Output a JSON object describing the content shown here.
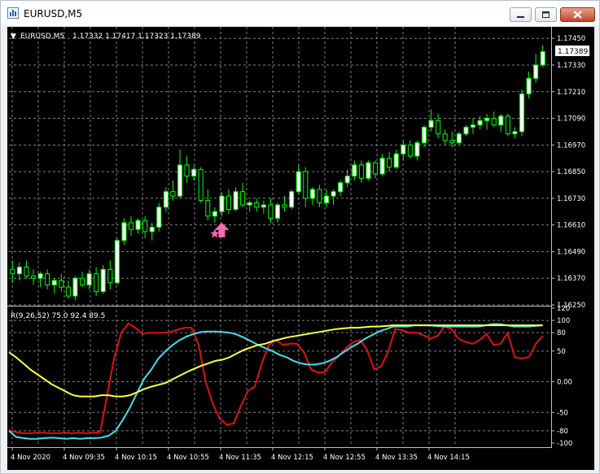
{
  "window": {
    "title": "EURUSD,M5"
  },
  "chart_header": {
    "symbol_tf": "EURUSD,M5",
    "ohlc": "1.17332 1.17417 1.17323 1.17389"
  },
  "indicator_header": {
    "label": "R(9,26,52) 75.0 92.4 89.5"
  },
  "colors": {
    "background": "#000000",
    "grid": "#808080",
    "bull_candle": "#ffffff",
    "bear_candle": "#000000",
    "wick": "#00ff00",
    "line_red": "#e01010",
    "line_cyan": "#40e0f0",
    "line_yellow": "#ffff40",
    "arrow": "#ff69b4",
    "price_label_bg": "#ffffff"
  },
  "price_axis": {
    "ticks": [
      "1.17450",
      "1.17330",
      "1.17210",
      "1.17090",
      "1.16970",
      "1.16850",
      "1.16730",
      "1.16610",
      "1.16490",
      "1.16370",
      "1.16250"
    ],
    "current_price": "1.17389"
  },
  "indicator_axis": {
    "ticks": [
      "120",
      "100",
      "80",
      "50",
      "0.00",
      "-50",
      "-80",
      "-100"
    ]
  },
  "time_axis": {
    "labels": [
      "4 Nov 2020",
      "4 Nov 09:35",
      "4 Nov 10:15",
      "4 Nov 10:55",
      "4 Nov 11:35",
      "4 Nov 12:15",
      "4 Nov 12:55",
      "4 Nov 13:35",
      "4 Nov 14:15"
    ]
  },
  "chart_data": [
    {
      "type": "candlestick",
      "title": "EURUSD,M5",
      "ylim": [
        1.1625,
        1.1748
      ],
      "candles": [
        {
          "o": 1.1641,
          "h": 1.1645,
          "l": 1.1635,
          "c": 1.1639
        },
        {
          "o": 1.1639,
          "h": 1.1644,
          "l": 1.1636,
          "c": 1.1642
        },
        {
          "o": 1.1642,
          "h": 1.1645,
          "l": 1.1637,
          "c": 1.1638
        },
        {
          "o": 1.1638,
          "h": 1.1641,
          "l": 1.1634,
          "c": 1.1637
        },
        {
          "o": 1.1637,
          "h": 1.164,
          "l": 1.1633,
          "c": 1.1639
        },
        {
          "o": 1.1639,
          "h": 1.1641,
          "l": 1.1632,
          "c": 1.1634
        },
        {
          "o": 1.1634,
          "h": 1.1637,
          "l": 1.163,
          "c": 1.1636
        },
        {
          "o": 1.1636,
          "h": 1.1639,
          "l": 1.1631,
          "c": 1.1633
        },
        {
          "o": 1.1633,
          "h": 1.1636,
          "l": 1.1628,
          "c": 1.1629
        },
        {
          "o": 1.1629,
          "h": 1.1638,
          "l": 1.1627,
          "c": 1.1637
        },
        {
          "o": 1.1637,
          "h": 1.164,
          "l": 1.1633,
          "c": 1.1634
        },
        {
          "o": 1.1634,
          "h": 1.1641,
          "l": 1.1632,
          "c": 1.1639
        },
        {
          "o": 1.1639,
          "h": 1.1642,
          "l": 1.1629,
          "c": 1.1631
        },
        {
          "o": 1.1631,
          "h": 1.1643,
          "l": 1.163,
          "c": 1.1641
        },
        {
          "o": 1.1641,
          "h": 1.1645,
          "l": 1.1632,
          "c": 1.1635
        },
        {
          "o": 1.1635,
          "h": 1.1655,
          "l": 1.1634,
          "c": 1.1654
        },
        {
          "o": 1.1654,
          "h": 1.1664,
          "l": 1.1652,
          "c": 1.1662
        },
        {
          "o": 1.1662,
          "h": 1.1665,
          "l": 1.1656,
          "c": 1.1659
        },
        {
          "o": 1.1659,
          "h": 1.1664,
          "l": 1.1657,
          "c": 1.1663
        },
        {
          "o": 1.1663,
          "h": 1.1665,
          "l": 1.1655,
          "c": 1.1658
        },
        {
          "o": 1.1658,
          "h": 1.1662,
          "l": 1.1654,
          "c": 1.166
        },
        {
          "o": 1.166,
          "h": 1.1671,
          "l": 1.1658,
          "c": 1.1669
        },
        {
          "o": 1.1669,
          "h": 1.1678,
          "l": 1.1667,
          "c": 1.1676
        },
        {
          "o": 1.1676,
          "h": 1.1681,
          "l": 1.1672,
          "c": 1.1674
        },
        {
          "o": 1.1674,
          "h": 1.1695,
          "l": 1.1673,
          "c": 1.1688
        },
        {
          "o": 1.1688,
          "h": 1.1692,
          "l": 1.168,
          "c": 1.1683
        },
        {
          "o": 1.1683,
          "h": 1.1688,
          "l": 1.1681,
          "c": 1.1686
        },
        {
          "o": 1.1686,
          "h": 1.1687,
          "l": 1.1671,
          "c": 1.1672
        },
        {
          "o": 1.1672,
          "h": 1.1677,
          "l": 1.1663,
          "c": 1.1665
        },
        {
          "o": 1.1665,
          "h": 1.1669,
          "l": 1.1662,
          "c": 1.1667
        },
        {
          "o": 1.1667,
          "h": 1.1676,
          "l": 1.1665,
          "c": 1.1674
        },
        {
          "o": 1.1674,
          "h": 1.1677,
          "l": 1.1666,
          "c": 1.1668
        },
        {
          "o": 1.1668,
          "h": 1.1678,
          "l": 1.1667,
          "c": 1.1676
        },
        {
          "o": 1.1676,
          "h": 1.168,
          "l": 1.1669,
          "c": 1.167
        },
        {
          "o": 1.167,
          "h": 1.1672,
          "l": 1.1667,
          "c": 1.1671
        },
        {
          "o": 1.1671,
          "h": 1.1673,
          "l": 1.1667,
          "c": 1.1669
        },
        {
          "o": 1.1669,
          "h": 1.1672,
          "l": 1.1666,
          "c": 1.167
        },
        {
          "o": 1.167,
          "h": 1.1673,
          "l": 1.1662,
          "c": 1.1664
        },
        {
          "o": 1.1664,
          "h": 1.1671,
          "l": 1.1662,
          "c": 1.167
        },
        {
          "o": 1.167,
          "h": 1.1674,
          "l": 1.1667,
          "c": 1.1669
        },
        {
          "o": 1.1669,
          "h": 1.1677,
          "l": 1.1668,
          "c": 1.1676
        },
        {
          "o": 1.1676,
          "h": 1.1688,
          "l": 1.1675,
          "c": 1.1685
        },
        {
          "o": 1.1685,
          "h": 1.1687,
          "l": 1.1669,
          "c": 1.1673
        },
        {
          "o": 1.1673,
          "h": 1.1678,
          "l": 1.167,
          "c": 1.1677
        },
        {
          "o": 1.1677,
          "h": 1.1679,
          "l": 1.1669,
          "c": 1.1671
        },
        {
          "o": 1.1671,
          "h": 1.1677,
          "l": 1.1669,
          "c": 1.1674
        },
        {
          "o": 1.1674,
          "h": 1.1677,
          "l": 1.167,
          "c": 1.1676
        },
        {
          "o": 1.1676,
          "h": 1.1681,
          "l": 1.1674,
          "c": 1.168
        },
        {
          "o": 1.168,
          "h": 1.1686,
          "l": 1.1678,
          "c": 1.1683
        },
        {
          "o": 1.1683,
          "h": 1.169,
          "l": 1.1681,
          "c": 1.1688
        },
        {
          "o": 1.1688,
          "h": 1.169,
          "l": 1.168,
          "c": 1.1682
        },
        {
          "o": 1.1682,
          "h": 1.169,
          "l": 1.1681,
          "c": 1.1689
        },
        {
          "o": 1.1689,
          "h": 1.169,
          "l": 1.1682,
          "c": 1.1684
        },
        {
          "o": 1.1684,
          "h": 1.1693,
          "l": 1.1683,
          "c": 1.1691
        },
        {
          "o": 1.1691,
          "h": 1.1694,
          "l": 1.1685,
          "c": 1.1687
        },
        {
          "o": 1.1687,
          "h": 1.1695,
          "l": 1.1686,
          "c": 1.1693
        },
        {
          "o": 1.1693,
          "h": 1.1699,
          "l": 1.169,
          "c": 1.1697
        },
        {
          "o": 1.1697,
          "h": 1.1699,
          "l": 1.1691,
          "c": 1.1692
        },
        {
          "o": 1.1692,
          "h": 1.1699,
          "l": 1.169,
          "c": 1.1698
        },
        {
          "o": 1.1698,
          "h": 1.1706,
          "l": 1.1696,
          "c": 1.1705
        },
        {
          "o": 1.1705,
          "h": 1.1713,
          "l": 1.1703,
          "c": 1.1708
        },
        {
          "o": 1.1708,
          "h": 1.1711,
          "l": 1.17,
          "c": 1.1702
        },
        {
          "o": 1.1702,
          "h": 1.1704,
          "l": 1.1697,
          "c": 1.1699
        },
        {
          "o": 1.1699,
          "h": 1.1703,
          "l": 1.1696,
          "c": 1.1698
        },
        {
          "o": 1.1698,
          "h": 1.1703,
          "l": 1.1697,
          "c": 1.1702
        },
        {
          "o": 1.1702,
          "h": 1.1706,
          "l": 1.1701,
          "c": 1.1705
        },
        {
          "o": 1.1705,
          "h": 1.1709,
          "l": 1.1702,
          "c": 1.1706
        },
        {
          "o": 1.1706,
          "h": 1.171,
          "l": 1.1704,
          "c": 1.1708
        },
        {
          "o": 1.1708,
          "h": 1.1711,
          "l": 1.1704,
          "c": 1.1709
        },
        {
          "o": 1.1709,
          "h": 1.1712,
          "l": 1.1705,
          "c": 1.1706
        },
        {
          "o": 1.1706,
          "h": 1.1711,
          "l": 1.1703,
          "c": 1.171
        },
        {
          "o": 1.171,
          "h": 1.1711,
          "l": 1.1701,
          "c": 1.1702
        },
        {
          "o": 1.1702,
          "h": 1.1705,
          "l": 1.17,
          "c": 1.1703
        },
        {
          "o": 1.1703,
          "h": 1.1722,
          "l": 1.1701,
          "c": 1.172
        },
        {
          "o": 1.172,
          "h": 1.173,
          "l": 1.1718,
          "c": 1.1727
        },
        {
          "o": 1.1727,
          "h": 1.1738,
          "l": 1.1725,
          "c": 1.1733
        },
        {
          "o": 1.1733,
          "h": 1.1742,
          "l": 1.1732,
          "c": 1.1739
        }
      ],
      "markers": [
        {
          "kind": "arrow-up",
          "index": 30,
          "price": 1.1662
        },
        {
          "kind": "star",
          "index": 29,
          "price": 1.1657
        }
      ]
    },
    {
      "type": "line",
      "title": "R(9,26,52)",
      "ylim": [
        -104,
        120
      ],
      "series": [
        {
          "color": "red",
          "values": [
            -79,
            -82,
            -84,
            -84,
            -83,
            -83,
            -84,
            -84,
            -83,
            -84,
            -83,
            -84,
            -83,
            -82,
            -20,
            40,
            80,
            95,
            88,
            78,
            80,
            80,
            80,
            81,
            85,
            88,
            88,
            60,
            0,
            -35,
            -60,
            -70,
            -68,
            -40,
            -15,
            -8,
            30,
            60,
            68,
            60,
            62,
            62,
            48,
            20,
            15,
            16,
            32,
            42,
            55,
            65,
            68,
            52,
            20,
            25,
            50,
            86,
            84,
            80,
            80,
            76,
            70,
            75,
            90,
            86,
            70,
            65,
            62,
            68,
            78,
            60,
            62,
            80,
            40,
            38,
            40,
            62,
            75
          ]
        },
        {
          "color": "cyan",
          "values": [
            -80,
            -90,
            -92,
            -93,
            -93,
            -92,
            -91,
            -92,
            -93,
            -92,
            -93,
            -92,
            -92,
            -91,
            -88,
            -80,
            -62,
            -42,
            -18,
            5,
            20,
            38,
            50,
            60,
            68,
            74,
            78,
            81,
            82,
            82,
            81,
            80,
            77,
            72,
            66,
            60,
            55,
            50,
            44,
            40,
            34,
            30,
            28,
            28,
            30,
            34,
            40,
            48,
            56,
            62,
            70,
            76,
            82,
            86,
            90,
            90,
            90,
            92,
            92,
            92,
            91,
            90,
            90,
            90,
            90,
            90,
            90,
            92,
            94,
            94,
            92,
            90,
            90,
            90,
            91,
            92
          ]
        },
        {
          "color": "yellow",
          "values": [
            48,
            40,
            30,
            20,
            12,
            4,
            -4,
            -10,
            -16,
            -22,
            -24,
            -24,
            -24,
            -22,
            -22,
            -24,
            -24,
            -22,
            -17,
            -12,
            -8,
            -5,
            -2,
            4,
            10,
            16,
            21,
            26,
            30,
            34,
            36,
            40,
            46,
            52,
            56,
            60,
            62,
            66,
            69,
            72,
            74,
            76,
            78,
            80,
            82,
            84,
            86,
            87,
            88,
            88,
            89,
            90,
            90,
            91,
            92,
            92,
            92,
            92,
            92,
            92,
            92,
            92,
            92,
            92,
            92,
            92,
            92,
            92,
            92,
            92,
            92,
            92,
            92,
            92,
            92,
            92
          ]
        }
      ]
    }
  ]
}
